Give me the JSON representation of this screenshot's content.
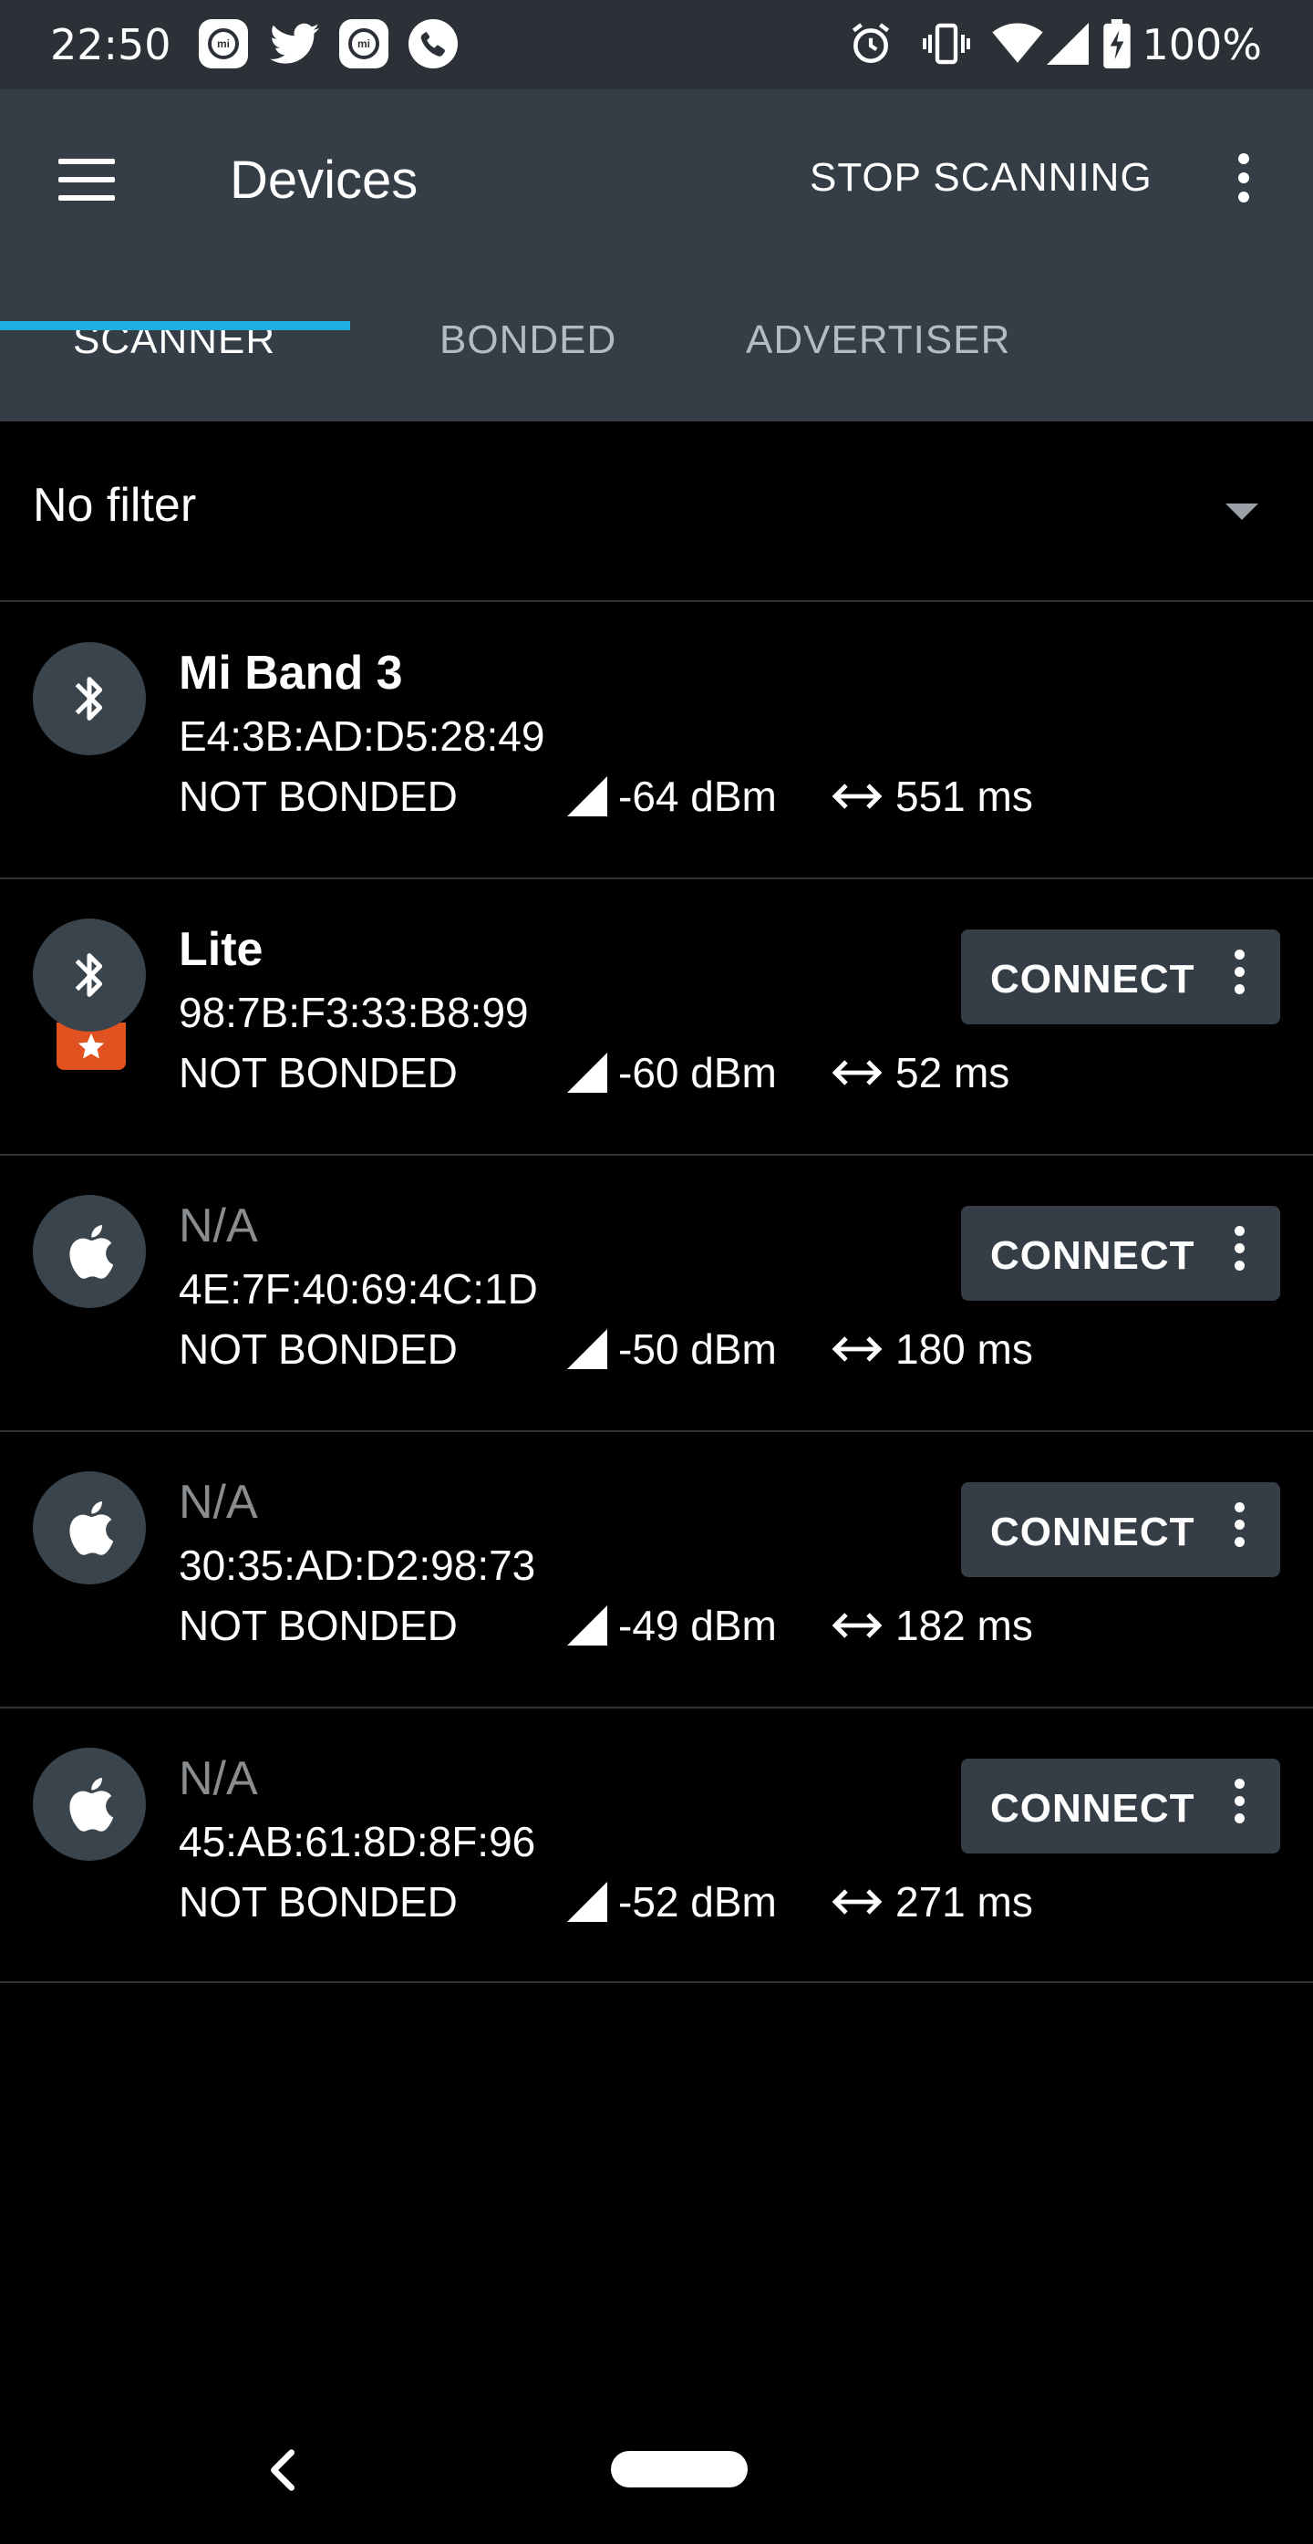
{
  "status_bar": {
    "time": "22:50",
    "battery": "100%",
    "icons": [
      "mi-fit-icon",
      "twitter-icon",
      "mi-fit-icon",
      "phone-icon",
      "alarm-icon",
      "vibrate-icon",
      "wifi-icon",
      "cell-signal-icon",
      "battery-charging-icon"
    ]
  },
  "app_bar": {
    "title": "Devices",
    "stop_scanning": "STOP SCANNING"
  },
  "tabs": [
    {
      "label": "SCANNER",
      "active": true
    },
    {
      "label": "BONDED",
      "active": false
    },
    {
      "label": "ADVERTISER",
      "active": false
    }
  ],
  "filter": {
    "label": "No filter"
  },
  "devices": [
    {
      "name": "Mi Band 3",
      "mac": "E4:3B:AD:D5:28:49",
      "bond": "NOT BONDED",
      "rssi": "-64 dBm",
      "interval": "551 ms",
      "icon": "bluetooth-icon",
      "connect": ""
    },
    {
      "name": "Lite",
      "mac": "98:7B:F3:33:B8:99",
      "bond": "NOT BONDED",
      "rssi": "-60 dBm",
      "interval": "52 ms",
      "icon": "bluetooth-icon",
      "connect": "CONNECT"
    },
    {
      "name": "N/A",
      "mac": "4E:7F:40:69:4C:1D",
      "bond": "NOT BONDED",
      "rssi": "-50 dBm",
      "interval": "180 ms",
      "icon": "apple-icon",
      "connect": "CONNECT"
    },
    {
      "name": "N/A",
      "mac": "30:35:AD:D2:98:73",
      "bond": "NOT BONDED",
      "rssi": "-49 dBm",
      "interval": "182 ms",
      "icon": "apple-icon",
      "connect": "CONNECT"
    },
    {
      "name": "N/A",
      "mac": "45:AB:61:8D:8F:96",
      "bond": "NOT BONDED",
      "rssi": "-52 dBm",
      "interval": "271 ms",
      "icon": "apple-icon",
      "connect": "CONNECT"
    }
  ],
  "colors": {
    "app_bar": "#353e47",
    "status_bar": "#2b3137",
    "tab_indicator": "#1faee0",
    "badge": "#e0521f",
    "background": "#000000"
  }
}
